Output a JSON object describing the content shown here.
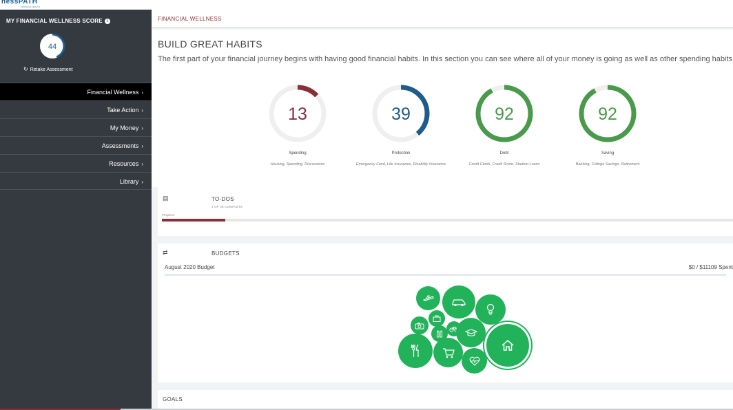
{
  "app": {
    "logo_text": "nessPATH",
    "logo_sub": "FINANCIAL HEALTH"
  },
  "sidebar": {
    "score_title": "MY FINANCIAL WELLNESS SCORE",
    "score_value": "44",
    "score_fraction": 0.44,
    "retake_label": "Retake Assessment",
    "menu": [
      {
        "label": "Financial Wellness",
        "active": true
      },
      {
        "label": "Take Action"
      },
      {
        "label": "My Money"
      },
      {
        "label": "Assessments"
      },
      {
        "label": "Resources"
      },
      {
        "label": "Library"
      }
    ]
  },
  "breadcrumb": "FINANCIAL WELLNESS",
  "habits": {
    "title": "BUILD GREAT HABITS",
    "description": "The first part of your financial journey begins with having good financial habits. In this section you can see where all of your money is going as well as other spending habits.",
    "gauges": [
      {
        "value": "13",
        "fraction": 0.13,
        "color": "#8a2f36",
        "label": "Spending",
        "sub": "Housing, Spending, Discussions"
      },
      {
        "value": "39",
        "fraction": 0.39,
        "color": "#1f5c8b",
        "label": "Protection",
        "sub": "Emergency Fund, Life Insurance, Disability Insurance"
      },
      {
        "value": "92",
        "fraction": 0.92,
        "color": "#4a9a4c",
        "label": "Debt",
        "sub": "Credit Cards, Credit Score, Student Loans"
      },
      {
        "value": "92",
        "fraction": 0.92,
        "color": "#4a9a4c",
        "label": "Saving",
        "sub": "Banking, College Savings, Retirement"
      }
    ]
  },
  "todos": {
    "title": "TO-DOS",
    "subtitle": "4 OF 36 COMPLETE",
    "progress_label": "Progress",
    "progress_fraction": 0.111,
    "progress_color": "#8a2f36"
  },
  "budgets": {
    "title": "BUDGETS",
    "budget_name": "August 2020 Budget",
    "budget_amount": "$0 / $11109 Spent",
    "bubble_color": "#21b25a",
    "bubbles": [
      {
        "icon": "airplane-icon"
      },
      {
        "icon": "car-icon"
      },
      {
        "icon": "lightbulb-icon"
      },
      {
        "icon": "briefcase-icon"
      },
      {
        "icon": "camera-icon"
      },
      {
        "icon": "bicycle-icon"
      },
      {
        "icon": "bottles-icon"
      },
      {
        "icon": "graduation-cap-icon"
      },
      {
        "icon": "utensils-icon"
      },
      {
        "icon": "shopping-cart-icon"
      },
      {
        "icon": "heartbeat-icon"
      },
      {
        "icon": "house-icon"
      }
    ]
  },
  "goals": {
    "title": "GOALS"
  }
}
